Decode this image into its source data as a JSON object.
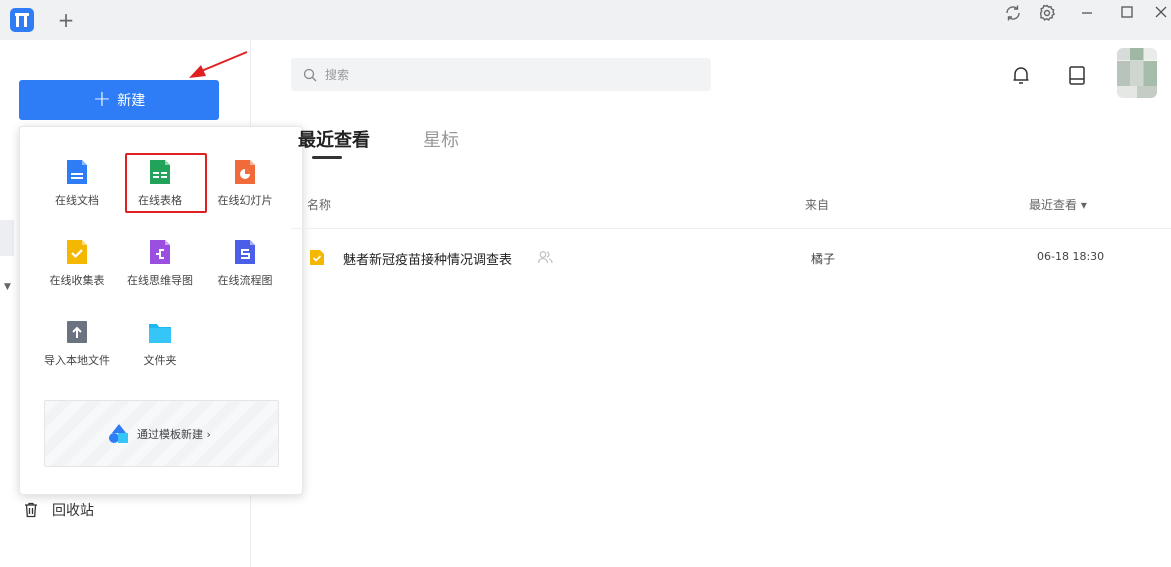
{
  "colors": {
    "accent": "#2e7cf6",
    "highlight_frame": "#e02020",
    "annotation_arrow": "#e02020"
  },
  "topbar": {
    "new_tab_label": "+"
  },
  "sidebar": {
    "new_button_label": "新建",
    "trash_label": "回收站"
  },
  "new_menu": {
    "items": [
      {
        "label": "在线文档",
        "icon": "doc-icon"
      },
      {
        "label": "在线表格",
        "icon": "sheet-icon"
      },
      {
        "label": "在线幻灯片",
        "icon": "slides-icon"
      },
      {
        "label": "在线收集表",
        "icon": "form-icon"
      },
      {
        "label": "在线思维导图",
        "icon": "mindmap-icon"
      },
      {
        "label": "在线流程图",
        "icon": "flowchart-icon"
      },
      {
        "label": "导入本地文件",
        "icon": "import-icon"
      },
      {
        "label": "文件夹",
        "icon": "folder-icon"
      }
    ],
    "template_label": "通过模板新建 ›"
  },
  "search": {
    "placeholder": "搜索"
  },
  "tabs": {
    "recent": "最近查看",
    "starred": "星标"
  },
  "table": {
    "headers": {
      "name": "名称",
      "source": "来自",
      "viewed": "最近查看 ▾"
    },
    "rows": [
      {
        "name": "魅者新冠疫苗接种情况调查表",
        "source": "橘子",
        "time": "06-18 18:30"
      }
    ]
  }
}
